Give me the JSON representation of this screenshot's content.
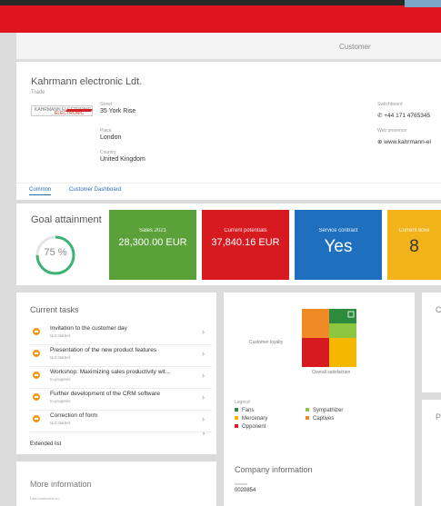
{
  "header": {
    "page_title": "Customer"
  },
  "company": {
    "name": "Kahrmann electronic Ldt.",
    "type": "Trade",
    "logo_line1": "KAHRMANN ELECTRONIC",
    "logo_line2": "ELECTRONIC",
    "street_label": "Street",
    "street": "35 York Rise",
    "place_label": "Place",
    "place": "London",
    "country_label": "Country",
    "country": "United Kingdom",
    "phone_label": "Switchboard",
    "phone": "+44 171 4765345",
    "web_label": "Web presence",
    "web": "www.kahrmann-el"
  },
  "tabs": [
    {
      "label": "Common",
      "active": true
    },
    {
      "label": "Customer Dashboard",
      "active": false
    }
  ],
  "goal": {
    "title": "Goal attainment",
    "percent_text": "75 %",
    "progress": 0.75,
    "tiles": [
      {
        "label": "Sales 2021",
        "value": "28,300.00 EUR",
        "color": "#5aa13a"
      },
      {
        "label": "Current potentials",
        "value": "37,840.16 EUR",
        "color": "#d71920"
      },
      {
        "label": "Service contract",
        "value": "Yes",
        "color": "#1f6fbf"
      },
      {
        "label": "Current ticke",
        "value": "8",
        "color": "#f2b21a"
      }
    ]
  },
  "tasks": {
    "title": "Current tasks",
    "items": [
      {
        "title": "Invitation to the customer day",
        "status": "Not started"
      },
      {
        "title": "Presentation of the new product features",
        "status": "Not started"
      },
      {
        "title": "Workshop: Maximizing sales productivity wit...",
        "status": "In progress"
      },
      {
        "title": "Further development of the CRM software",
        "status": "In progress"
      },
      {
        "title": "Correction of form",
        "status": "Not started"
      }
    ],
    "extended": "Extended list",
    "chevron": "›"
  },
  "matrix": {
    "y_label": "Customer loyalty",
    "x_label": "Overall satisfaction",
    "legend_title": "Legend",
    "legend": [
      {
        "label": "Fans",
        "color": "#2e8b3e"
      },
      {
        "label": "Sympathizer",
        "color": "#8dc63f"
      },
      {
        "label": "Mercenary",
        "color": "#f5b800"
      },
      {
        "label": "Captives",
        "color": "#f08a24"
      },
      {
        "label": "Opponent",
        "color": "#d71920"
      }
    ],
    "cells_top": [
      "#f08a24",
      "#2e8b3e",
      "#8dc63f"
    ],
    "cells_bottom": [
      "#d71920",
      "#f5b800"
    ]
  },
  "right_cards": [
    "C",
    "P"
  ],
  "more_info": {
    "title": "More information",
    "label": "Last contacted on"
  },
  "company_info": {
    "title": "Company information",
    "number_label": "Number",
    "number": "0020854"
  }
}
